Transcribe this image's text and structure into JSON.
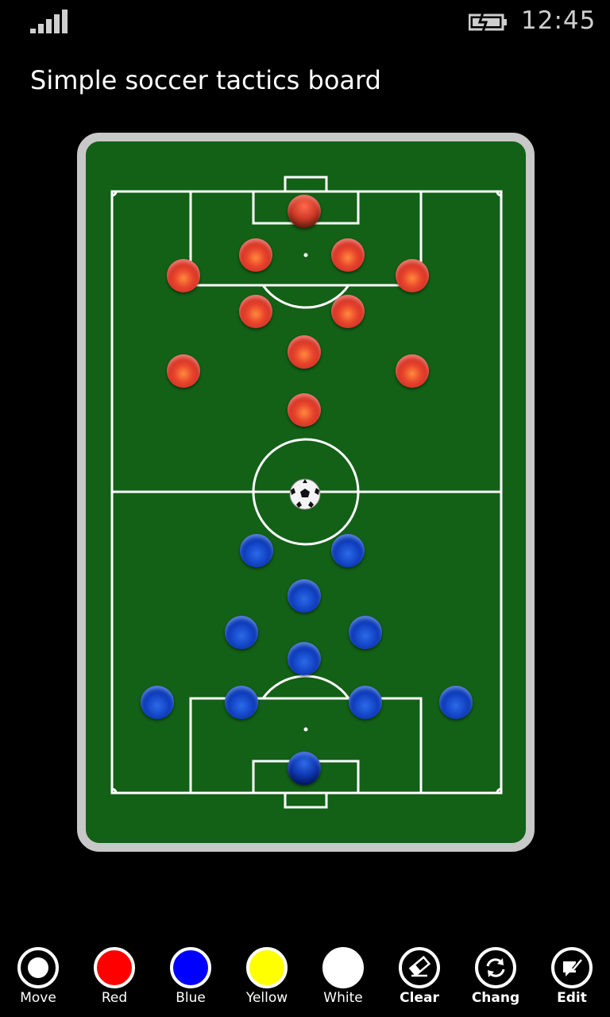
{
  "status": {
    "time": "12:45"
  },
  "app": {
    "title": "Simple soccer tactics board"
  },
  "colors": {
    "pitch": "#136017",
    "frame": "#c8c8c8",
    "red": "#e8452d",
    "blue": "#1040c0"
  },
  "appbar": {
    "buttons": [
      {
        "label": "Move",
        "icon": "move-icon"
      },
      {
        "label": "Red",
        "icon": "red-color-icon",
        "color": "#ff0000"
      },
      {
        "label": "Blue",
        "icon": "blue-color-icon",
        "color": "#0000ff"
      },
      {
        "label": "Yellow",
        "icon": "yellow-color-icon",
        "color": "#ffff00"
      },
      {
        "label": "White",
        "icon": "white-color-icon",
        "color": "#ffffff"
      },
      {
        "label": "Clear",
        "icon": "eraser-icon"
      },
      {
        "label": "Chang",
        "icon": "refresh-icon"
      },
      {
        "label": "Edit",
        "icon": "edit-icon"
      }
    ]
  }
}
